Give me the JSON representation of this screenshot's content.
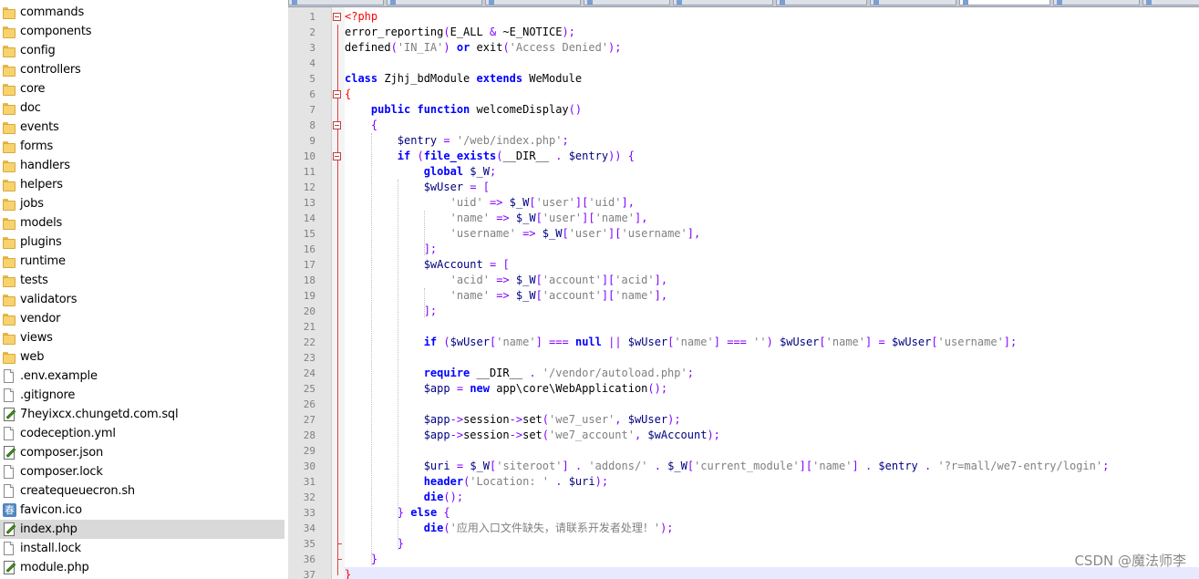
{
  "file_tree": {
    "selected": "index.php",
    "items": [
      {
        "label": "commands",
        "type": "folder"
      },
      {
        "label": "components",
        "type": "folder"
      },
      {
        "label": "config",
        "type": "folder"
      },
      {
        "label": "controllers",
        "type": "folder"
      },
      {
        "label": "core",
        "type": "folder"
      },
      {
        "label": "doc",
        "type": "folder"
      },
      {
        "label": "events",
        "type": "folder"
      },
      {
        "label": "forms",
        "type": "folder"
      },
      {
        "label": "handlers",
        "type": "folder"
      },
      {
        "label": "helpers",
        "type": "folder"
      },
      {
        "label": "jobs",
        "type": "folder"
      },
      {
        "label": "models",
        "type": "folder"
      },
      {
        "label": "plugins",
        "type": "folder"
      },
      {
        "label": "runtime",
        "type": "folder"
      },
      {
        "label": "tests",
        "type": "folder"
      },
      {
        "label": "validators",
        "type": "folder"
      },
      {
        "label": "vendor",
        "type": "folder"
      },
      {
        "label": "views",
        "type": "folder"
      },
      {
        "label": "web",
        "type": "folder"
      },
      {
        "label": ".env.example",
        "type": "file"
      },
      {
        "label": ".gitignore",
        "type": "file"
      },
      {
        "label": "7heyixcx.chungetd.com.sql",
        "type": "edit"
      },
      {
        "label": "codeception.yml",
        "type": "file"
      },
      {
        "label": "composer.json",
        "type": "edit"
      },
      {
        "label": "composer.lock",
        "type": "file"
      },
      {
        "label": "createqueuecron.sh",
        "type": "file"
      },
      {
        "label": "favicon.ico",
        "type": "image"
      },
      {
        "label": "index.php",
        "type": "edit"
      },
      {
        "label": "install.lock",
        "type": "file"
      },
      {
        "label": "module.php",
        "type": "edit"
      }
    ]
  },
  "editor": {
    "tabs": [
      {
        "label": "",
        "active": false
      },
      {
        "label": "",
        "active": false
      },
      {
        "label": "",
        "active": false
      },
      {
        "label": "",
        "active": false
      },
      {
        "label": "",
        "active": false
      },
      {
        "label": "",
        "active": false
      },
      {
        "label": "",
        "active": false
      },
      {
        "label": "",
        "active": true
      },
      {
        "label": "",
        "active": false
      },
      {
        "label": "",
        "active": false
      }
    ],
    "current_line": 37,
    "lines": [
      [
        [
          "php",
          "<?php"
        ]
      ],
      [
        [
          "fn",
          "error_reporting"
        ],
        [
          "op",
          "("
        ],
        [
          "fn",
          "E_ALL "
        ],
        [
          "op",
          "&"
        ],
        [
          "fn",
          " ~E_NOTICE"
        ],
        [
          "op",
          ");"
        ]
      ],
      [
        [
          "fn",
          "defined"
        ],
        [
          "op",
          "("
        ],
        [
          "str",
          "'IN_IA'"
        ],
        [
          "op",
          ")"
        ],
        [
          "fn",
          " "
        ],
        [
          "kw",
          "or"
        ],
        [
          "fn",
          " exit"
        ],
        [
          "op",
          "("
        ],
        [
          "str",
          "'Access Denied'"
        ],
        [
          "op",
          ");"
        ]
      ],
      [],
      [
        [
          "kw",
          "class"
        ],
        [
          "fn",
          " Zjhj_bdModule "
        ],
        [
          "kw",
          "extends"
        ],
        [
          "fn",
          " WeModule"
        ]
      ],
      [
        [
          "php",
          "{"
        ]
      ],
      [
        [
          "fn",
          "    "
        ],
        [
          "kw",
          "public function"
        ],
        [
          "fn",
          " welcomeDisplay"
        ],
        [
          "op",
          "()"
        ]
      ],
      [
        [
          "fn",
          "    "
        ],
        [
          "op",
          "{"
        ]
      ],
      [
        [
          "fn",
          "        "
        ],
        [
          "var",
          "$entry"
        ],
        [
          "fn",
          " "
        ],
        [
          "op",
          "="
        ],
        [
          "fn",
          " "
        ],
        [
          "str",
          "'/web/index.php'"
        ],
        [
          "op",
          ";"
        ]
      ],
      [
        [
          "fn",
          "        "
        ],
        [
          "kw",
          "if"
        ],
        [
          "fn",
          " "
        ],
        [
          "op",
          "("
        ],
        [
          "kw",
          "file_exists"
        ],
        [
          "op",
          "("
        ],
        [
          "fn",
          "__DIR__ "
        ],
        [
          "op",
          "."
        ],
        [
          "fn",
          " "
        ],
        [
          "var",
          "$entry"
        ],
        [
          "op",
          "))"
        ],
        [
          "fn",
          " "
        ],
        [
          "op",
          "{"
        ]
      ],
      [
        [
          "fn",
          "            "
        ],
        [
          "kw",
          "global"
        ],
        [
          "fn",
          " "
        ],
        [
          "var",
          "$_W"
        ],
        [
          "op",
          ";"
        ]
      ],
      [
        [
          "fn",
          "            "
        ],
        [
          "var",
          "$wUser"
        ],
        [
          "fn",
          " "
        ],
        [
          "op",
          "="
        ],
        [
          "fn",
          " "
        ],
        [
          "op",
          "["
        ]
      ],
      [
        [
          "fn",
          "                "
        ],
        [
          "str",
          "'uid'"
        ],
        [
          "fn",
          " "
        ],
        [
          "op",
          "=>"
        ],
        [
          "fn",
          " "
        ],
        [
          "var",
          "$_W"
        ],
        [
          "op",
          "["
        ],
        [
          "str",
          "'user'"
        ],
        [
          "op",
          "]["
        ],
        [
          "str",
          "'uid'"
        ],
        [
          "op",
          "],"
        ]
      ],
      [
        [
          "fn",
          "                "
        ],
        [
          "str",
          "'name'"
        ],
        [
          "fn",
          " "
        ],
        [
          "op",
          "=>"
        ],
        [
          "fn",
          " "
        ],
        [
          "var",
          "$_W"
        ],
        [
          "op",
          "["
        ],
        [
          "str",
          "'user'"
        ],
        [
          "op",
          "]["
        ],
        [
          "str",
          "'name'"
        ],
        [
          "op",
          "],"
        ]
      ],
      [
        [
          "fn",
          "                "
        ],
        [
          "str",
          "'username'"
        ],
        [
          "fn",
          " "
        ],
        [
          "op",
          "=>"
        ],
        [
          "fn",
          " "
        ],
        [
          "var",
          "$_W"
        ],
        [
          "op",
          "["
        ],
        [
          "str",
          "'user'"
        ],
        [
          "op",
          "]["
        ],
        [
          "str",
          "'username'"
        ],
        [
          "op",
          "],"
        ]
      ],
      [
        [
          "fn",
          "            "
        ],
        [
          "op",
          "];"
        ]
      ],
      [
        [
          "fn",
          "            "
        ],
        [
          "var",
          "$wAccount"
        ],
        [
          "fn",
          " "
        ],
        [
          "op",
          "="
        ],
        [
          "fn",
          " "
        ],
        [
          "op",
          "["
        ]
      ],
      [
        [
          "fn",
          "                "
        ],
        [
          "str",
          "'acid'"
        ],
        [
          "fn",
          " "
        ],
        [
          "op",
          "=>"
        ],
        [
          "fn",
          " "
        ],
        [
          "var",
          "$_W"
        ],
        [
          "op",
          "["
        ],
        [
          "str",
          "'account'"
        ],
        [
          "op",
          "]["
        ],
        [
          "str",
          "'acid'"
        ],
        [
          "op",
          "],"
        ]
      ],
      [
        [
          "fn",
          "                "
        ],
        [
          "str",
          "'name'"
        ],
        [
          "fn",
          " "
        ],
        [
          "op",
          "=>"
        ],
        [
          "fn",
          " "
        ],
        [
          "var",
          "$_W"
        ],
        [
          "op",
          "["
        ],
        [
          "str",
          "'account'"
        ],
        [
          "op",
          "]["
        ],
        [
          "str",
          "'name'"
        ],
        [
          "op",
          "],"
        ]
      ],
      [
        [
          "fn",
          "            "
        ],
        [
          "op",
          "];"
        ]
      ],
      [],
      [
        [
          "fn",
          "            "
        ],
        [
          "kw",
          "if"
        ],
        [
          "fn",
          " "
        ],
        [
          "op",
          "("
        ],
        [
          "var",
          "$wUser"
        ],
        [
          "op",
          "["
        ],
        [
          "str",
          "'name'"
        ],
        [
          "op",
          "]"
        ],
        [
          "fn",
          " "
        ],
        [
          "op",
          "==="
        ],
        [
          "fn",
          " "
        ],
        [
          "kw",
          "null"
        ],
        [
          "fn",
          " "
        ],
        [
          "op",
          "||"
        ],
        [
          "fn",
          " "
        ],
        [
          "var",
          "$wUser"
        ],
        [
          "op",
          "["
        ],
        [
          "str",
          "'name'"
        ],
        [
          "op",
          "]"
        ],
        [
          "fn",
          " "
        ],
        [
          "op",
          "==="
        ],
        [
          "fn",
          " "
        ],
        [
          "str",
          "''"
        ],
        [
          "op",
          ")"
        ],
        [
          "fn",
          " "
        ],
        [
          "var",
          "$wUser"
        ],
        [
          "op",
          "["
        ],
        [
          "str",
          "'name'"
        ],
        [
          "op",
          "]"
        ],
        [
          "fn",
          " "
        ],
        [
          "op",
          "="
        ],
        [
          "fn",
          " "
        ],
        [
          "var",
          "$wUser"
        ],
        [
          "op",
          "["
        ],
        [
          "str",
          "'username'"
        ],
        [
          "op",
          "];"
        ]
      ],
      [],
      [
        [
          "fn",
          "            "
        ],
        [
          "kw",
          "require"
        ],
        [
          "fn",
          " __DIR__ "
        ],
        [
          "op",
          "."
        ],
        [
          "fn",
          " "
        ],
        [
          "str",
          "'/vendor/autoload.php'"
        ],
        [
          "op",
          ";"
        ]
      ],
      [
        [
          "fn",
          "            "
        ],
        [
          "var",
          "$app"
        ],
        [
          "fn",
          " "
        ],
        [
          "op",
          "="
        ],
        [
          "fn",
          " "
        ],
        [
          "kw",
          "new"
        ],
        [
          "fn",
          " app\\core\\WebApplication"
        ],
        [
          "op",
          "();"
        ]
      ],
      [],
      [
        [
          "fn",
          "            "
        ],
        [
          "var",
          "$app"
        ],
        [
          "op",
          "->"
        ],
        [
          "fn",
          "session"
        ],
        [
          "op",
          "->"
        ],
        [
          "fn",
          "set"
        ],
        [
          "op",
          "("
        ],
        [
          "str",
          "'we7_user'"
        ],
        [
          "op",
          ","
        ],
        [
          "fn",
          " "
        ],
        [
          "var",
          "$wUser"
        ],
        [
          "op",
          ");"
        ]
      ],
      [
        [
          "fn",
          "            "
        ],
        [
          "var",
          "$app"
        ],
        [
          "op",
          "->"
        ],
        [
          "fn",
          "session"
        ],
        [
          "op",
          "->"
        ],
        [
          "fn",
          "set"
        ],
        [
          "op",
          "("
        ],
        [
          "str",
          "'we7_account'"
        ],
        [
          "op",
          ","
        ],
        [
          "fn",
          " "
        ],
        [
          "var",
          "$wAccount"
        ],
        [
          "op",
          ");"
        ]
      ],
      [],
      [
        [
          "fn",
          "            "
        ],
        [
          "var",
          "$uri"
        ],
        [
          "fn",
          " "
        ],
        [
          "op",
          "="
        ],
        [
          "fn",
          " "
        ],
        [
          "var",
          "$_W"
        ],
        [
          "op",
          "["
        ],
        [
          "str",
          "'siteroot'"
        ],
        [
          "op",
          "]"
        ],
        [
          "fn",
          " "
        ],
        [
          "op",
          "."
        ],
        [
          "fn",
          " "
        ],
        [
          "str",
          "'addons/'"
        ],
        [
          "fn",
          " "
        ],
        [
          "op",
          "."
        ],
        [
          "fn",
          " "
        ],
        [
          "var",
          "$_W"
        ],
        [
          "op",
          "["
        ],
        [
          "str",
          "'current_module'"
        ],
        [
          "op",
          "]["
        ],
        [
          "str",
          "'name'"
        ],
        [
          "op",
          "]"
        ],
        [
          "fn",
          " "
        ],
        [
          "op",
          "."
        ],
        [
          "fn",
          " "
        ],
        [
          "var",
          "$entry"
        ],
        [
          "fn",
          " "
        ],
        [
          "op",
          "."
        ],
        [
          "fn",
          " "
        ],
        [
          "str",
          "'?r=mall/we7-entry/login'"
        ],
        [
          "op",
          ";"
        ]
      ],
      [
        [
          "fn",
          "            "
        ],
        [
          "kw",
          "header"
        ],
        [
          "op",
          "("
        ],
        [
          "str",
          "'Location: '"
        ],
        [
          "fn",
          " "
        ],
        [
          "op",
          "."
        ],
        [
          "fn",
          " "
        ],
        [
          "var",
          "$uri"
        ],
        [
          "op",
          ");"
        ]
      ],
      [
        [
          "fn",
          "            "
        ],
        [
          "kw",
          "die"
        ],
        [
          "op",
          "();"
        ]
      ],
      [
        [
          "fn",
          "        "
        ],
        [
          "op",
          "}"
        ],
        [
          "fn",
          " "
        ],
        [
          "kw",
          "else"
        ],
        [
          "fn",
          " "
        ],
        [
          "op",
          "{"
        ]
      ],
      [
        [
          "fn",
          "            "
        ],
        [
          "kw",
          "die"
        ],
        [
          "op",
          "("
        ],
        [
          "str",
          "'应用入口文件缺失，请联系开发者处理！'"
        ],
        [
          "op",
          ");"
        ]
      ],
      [
        [
          "fn",
          "        "
        ],
        [
          "op",
          "}"
        ]
      ],
      [
        [
          "fn",
          "    "
        ],
        [
          "op",
          "}"
        ]
      ],
      [
        [
          "php",
          "}"
        ]
      ]
    ]
  },
  "watermark": "CSDN @魔法师李"
}
